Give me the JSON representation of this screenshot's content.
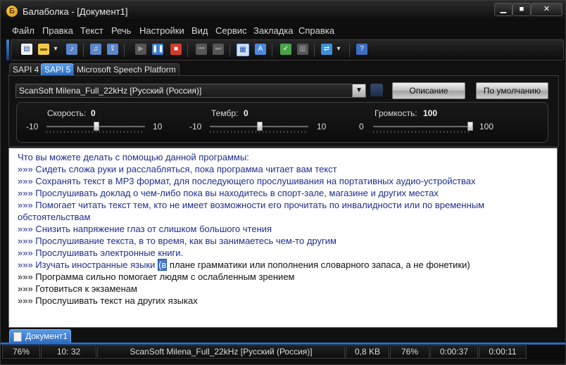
{
  "window": {
    "title": "Балаболка - [Документ1]",
    "min_glyph": "▁",
    "max_glyph": "■",
    "close_glyph": "✕"
  },
  "menu": [
    "Файл",
    "Правка",
    "Текст",
    "Речь",
    "Настройки",
    "Вид",
    "Сервис",
    "Закладка",
    "Справка"
  ],
  "toolbar": {
    "icons": [
      "new-document-icon",
      "open-folder-icon",
      "dropdown-icon",
      "save-audio-icon",
      "save-audio-split-icon",
      "export-icon",
      "play-icon",
      "pause-icon",
      "stop-icon",
      "skip-icon",
      "skip-icon-2",
      "voice-settings-icon",
      "dictionary-icon",
      "spell-check-icon",
      "clipboard-icon",
      "convert-icon",
      "dropdown-icon",
      "help-icon"
    ]
  },
  "tabs": [
    "SAPI 4",
    "SAPI 5",
    "Microsoft Speech Platform"
  ],
  "voice": {
    "selected": "ScanSoft Milena_Full_22kHz [Русский (Россия)]",
    "describe_label": "Описание",
    "default_label": "По умолчанию"
  },
  "sliders": {
    "speed": {
      "label": "Скорость:",
      "value": "0",
      "min": "-10",
      "max": "10",
      "fraction": 0.5
    },
    "pitch": {
      "label": "Тембр:",
      "value": "0",
      "min": "-10",
      "max": "10",
      "fraction": 0.5
    },
    "volume": {
      "label": "Громкость:",
      "value": "100",
      "min": "0",
      "max": "100",
      "fraction": 1.0
    }
  },
  "editor": {
    "lines": [
      "Что вы можете делать с помощью данной программы:",
      "»»»  Сидеть сложа руки и расслабляться, пока программа читает вам текст",
      "»»»  Сохранять текст в MP3 формат, для последующего прослушивания на портативных аудио-устройствах",
      "»»»  Прослушивать доклад о чем-либо пока вы находитесь в спорт-зале, магазине и других местах",
      "»»»  Помогает читать текст тем, кто не имеет возможности его прочитать по инвалидности или по временным",
      "обстоятельствам",
      "»»»  Снизить напряжение глаз от слишком большого чтения",
      "»»»  Прослушивание текста, в то время, как вы занимаетесь чем-то другим",
      "»»»  Прослушивать электронные книги."
    ],
    "highlight_line": {
      "before": "»»»  Изучать иностранные языки ",
      "selected": "(в",
      "after": " плане грамматики или пополнения словарного запаса, а не фонетики)"
    },
    "dark_lines": [
      "»»»  Программа сильно помогает людям с ослабленным зрением",
      "»»»  Готовиться к экзаменам",
      "»»»  Прослушивать текст на других языках"
    ]
  },
  "document_tab": "Документ1",
  "status": {
    "zoom": "76%",
    "position": "10:  32",
    "voice": "ScanSoft Milena_Full_22kHz [Русский (Россия)]",
    "size": "0,8 KB",
    "progress": "76%",
    "elapsed": "0:00:37",
    "remaining": "0:00:11"
  }
}
